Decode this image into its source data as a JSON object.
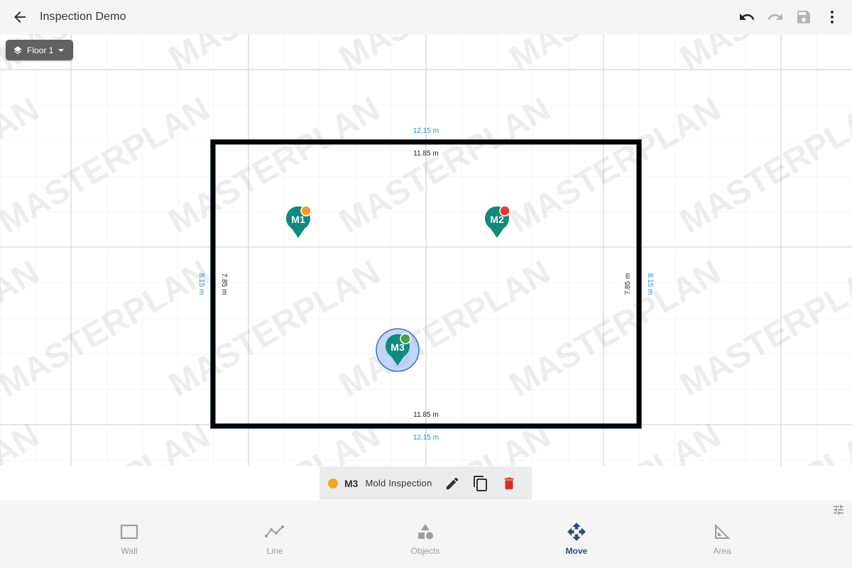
{
  "header": {
    "back_icon": "arrow-left-icon",
    "title": "Inspection Demo",
    "undo_icon": "undo-icon",
    "redo_icon": "redo-icon",
    "save_icon": "save-icon",
    "more_icon": "more-vertical-icon"
  },
  "floor_selector": {
    "label": "Floor 1",
    "icon": "layers-icon"
  },
  "canvas": {
    "watermark": "MASTERPLAN",
    "dimensions": {
      "outer_top": "12.15 m",
      "inner_top": "11.85 m",
      "inner_bottom": "11.85 m",
      "outer_bottom": "12.15 m",
      "outer_left": "8.15 m",
      "inner_left": "7.85 m",
      "inner_right": "7.85 m",
      "outer_right": "8.15 m"
    },
    "markers": [
      {
        "label": "M1",
        "status_color": "#f59a23",
        "selected": false
      },
      {
        "label": "M2",
        "status_color": "#e53935",
        "selected": false
      },
      {
        "label": "M3",
        "status_color": "#43a047",
        "selected": true
      }
    ],
    "colors": {
      "marker": "#0f8a7c",
      "wall": "#000000",
      "wall_outline": "#1e88e5",
      "selection": "#8fb4f0"
    }
  },
  "selection_bar": {
    "status_color": "#f5a623",
    "code": "M3",
    "name": "Mold Inspection",
    "edit_icon": "pencil-icon",
    "copy_icon": "copy-icon",
    "delete_icon": "trash-icon"
  },
  "bottom_nav": {
    "settings_icon": "tune-icon",
    "items": [
      {
        "label": "Wall",
        "icon": "rectangle-icon",
        "active": false
      },
      {
        "label": "Line",
        "icon": "polyline-icon",
        "active": false
      },
      {
        "label": "Objects",
        "icon": "shapes-icon",
        "active": false
      },
      {
        "label": "Move",
        "icon": "move-arrows-icon",
        "active": true
      },
      {
        "label": "Area",
        "icon": "area-ruler-icon",
        "active": false
      }
    ]
  }
}
